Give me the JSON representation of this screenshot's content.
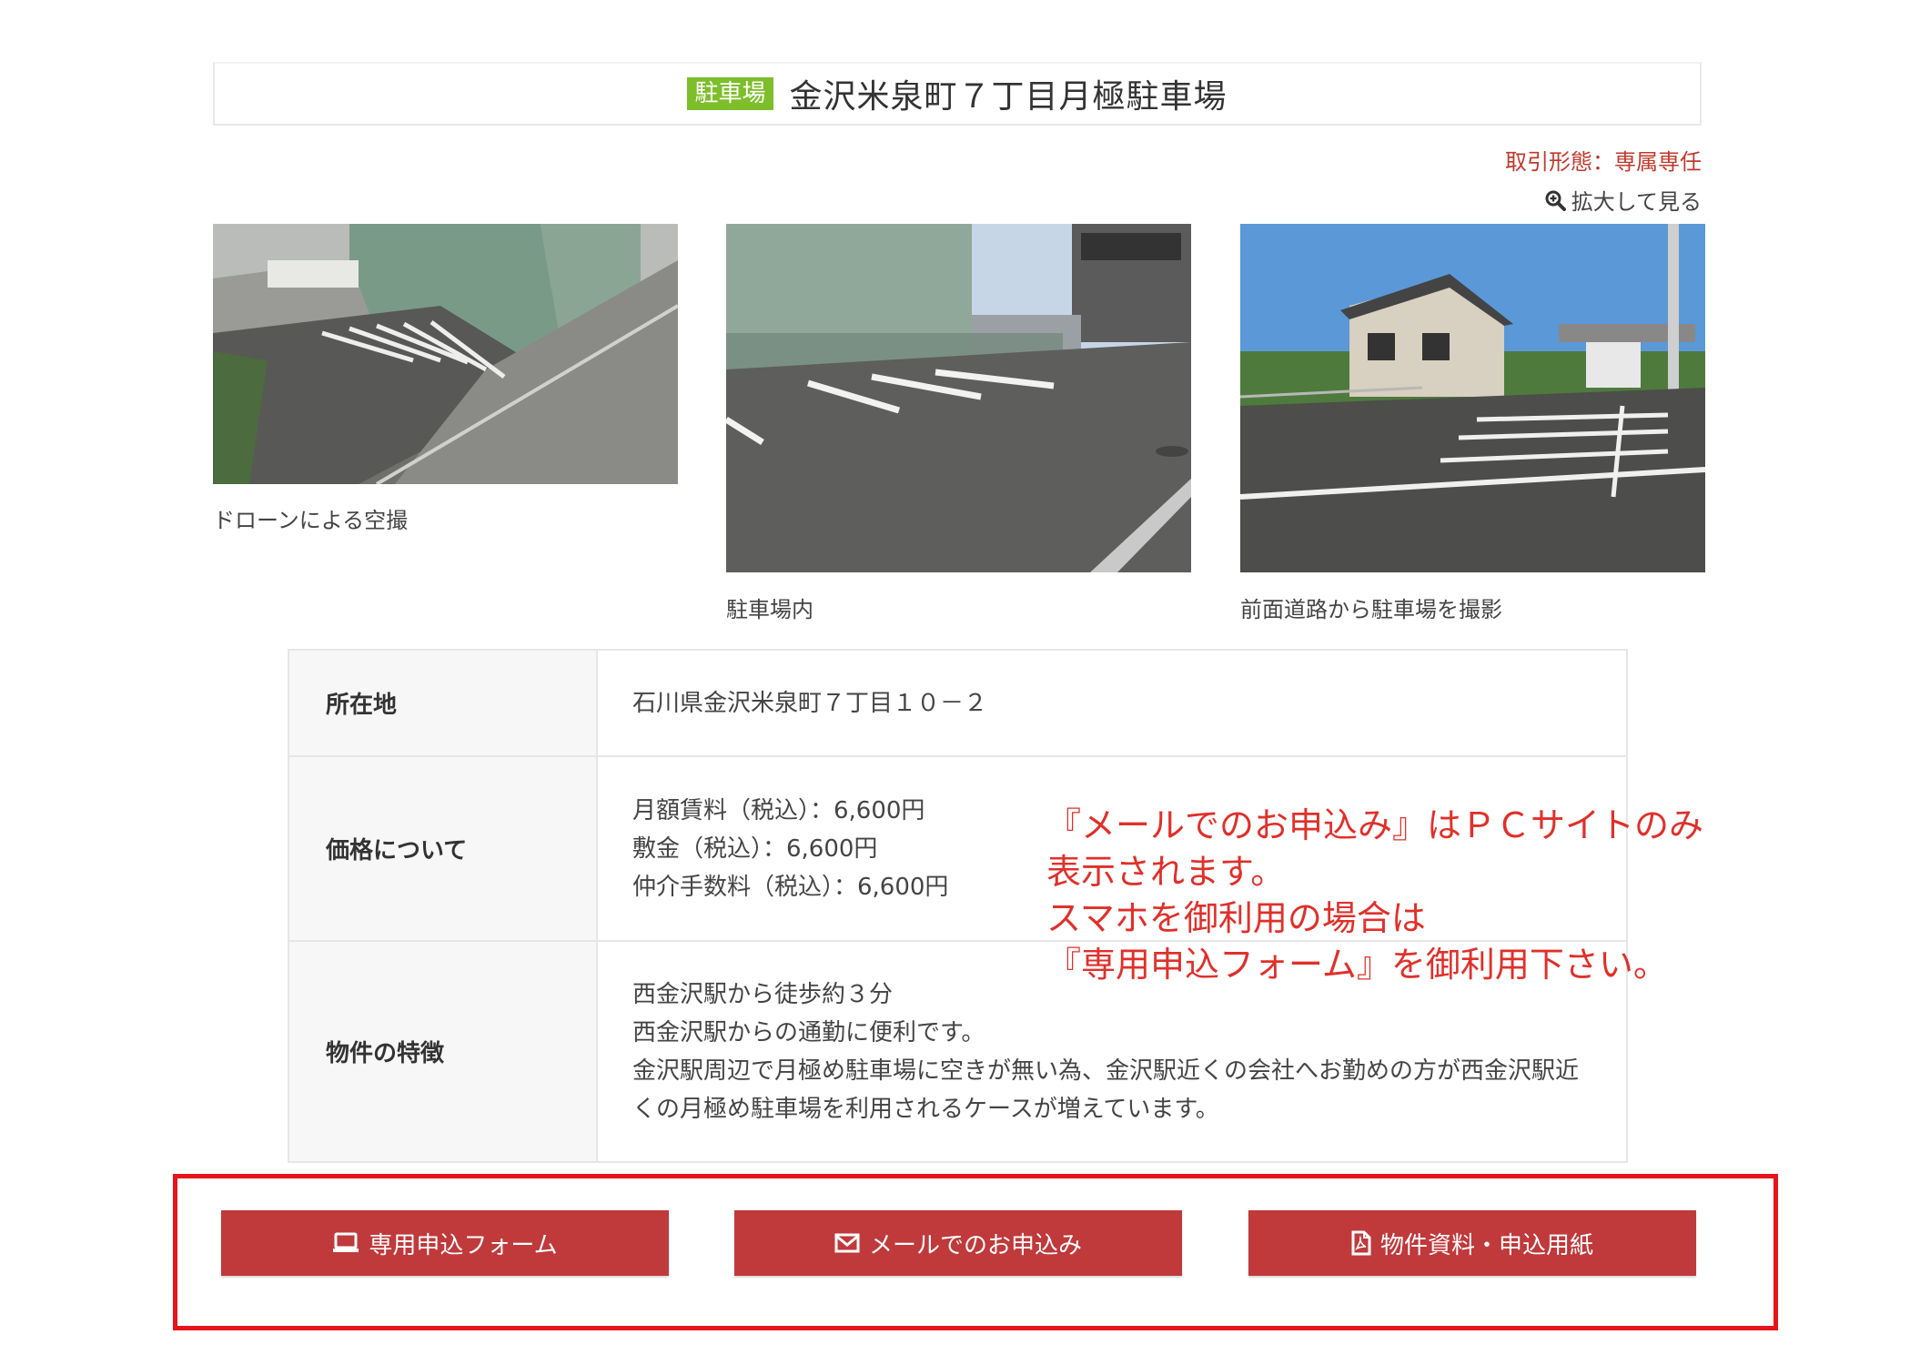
{
  "header": {
    "category_badge": "駐車場",
    "title": "金沢米泉町７丁目月極駐車場"
  },
  "meta": {
    "deal_type": "取引形態：専属専任",
    "zoom_label": "拡大して見る"
  },
  "photos": [
    {
      "caption": "ドローンによる空撮"
    },
    {
      "caption": "駐車場内"
    },
    {
      "caption": "前面道路から駐車場を撮影"
    }
  ],
  "details": {
    "address_label": "所在地",
    "address_value": "石川県金沢米泉町７丁目１０－２",
    "price_label": "価格について",
    "price_lines": [
      "月額賃料（税込）：6,600円",
      "敷金（税込）：6,600円",
      "仲介手数料（税込）：6,600円"
    ],
    "feature_label": "物件の特徴",
    "feature_lines": [
      "西金沢駅から徒歩約３分",
      "西金沢駅からの通勤に便利です。",
      "金沢駅周辺で月極め駐車場に空きが無い為、金沢駅近くの会社へお勤めの方が西金沢駅近",
      "くの月極め駐車場を利用されるケースが増えています。"
    ]
  },
  "note": {
    "lines": [
      "『メールでのお申込み』はＰＣサイトのみ",
      "表示されます。",
      "スマホを御利用の場合は",
      "『専用申込フォーム』を御利用下さい。"
    ]
  },
  "actions": {
    "form_label": "専用申込フォーム",
    "mail_label": "メールでのお申込み",
    "docs_label": "物件資料・申込用紙"
  },
  "colors": {
    "badge": "#7dbe2a",
    "button": "#c0393b",
    "frame": "#e8141b",
    "note": "#e0302a"
  }
}
